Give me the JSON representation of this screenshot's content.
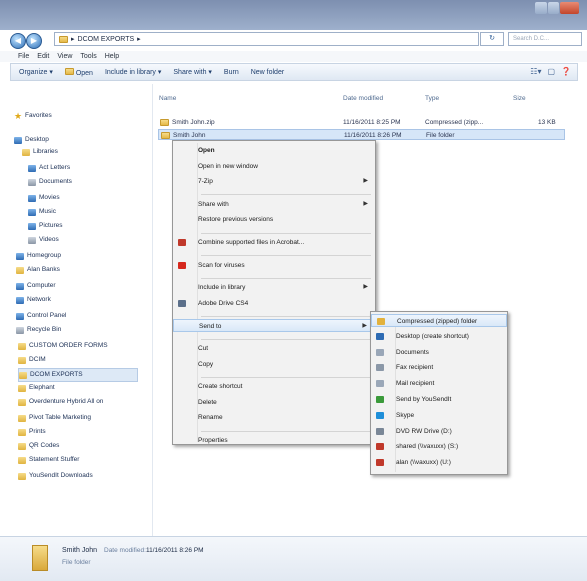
{
  "window": {
    "path": [
      "DCOM EXPORTS"
    ],
    "search_placeholder": "Search D.C...",
    "refresh_label": "↻"
  },
  "menubar": [
    "File",
    "Edit",
    "View",
    "Tools",
    "Help"
  ],
  "toolbar": {
    "organize": "Organize ▾",
    "open": "Open",
    "include": "Include in library ▾",
    "share": "Share with ▾",
    "burn": "Burn",
    "newfolder": "New folder"
  },
  "columns": {
    "name": "Name",
    "date": "Date modified",
    "type": "Type",
    "size": "Size"
  },
  "files": [
    {
      "name": "Smith John.zip",
      "date": "11/16/2011 8:25 PM",
      "type": "Compressed (zipp...",
      "size": "13 KB"
    },
    {
      "name": "Smith John",
      "date": "11/16/2011 8:26 PM",
      "type": "File folder",
      "size": ""
    }
  ],
  "nav": [
    {
      "label": "Favorites",
      "icon": "star"
    },
    {
      "label": "Desktop",
      "icon": "blue"
    },
    {
      "label": "Libraries",
      "icon": "yellow"
    },
    {
      "label": "Act Letters",
      "icon": "blue"
    },
    {
      "label": "Documents",
      "icon": "gray"
    },
    {
      "label": "Movies",
      "icon": "blue"
    },
    {
      "label": "Music",
      "icon": "blue"
    },
    {
      "label": "Pictures",
      "icon": "blue"
    },
    {
      "label": "Videos",
      "icon": "gray"
    },
    {
      "label": "Homegroup",
      "icon": "blue"
    },
    {
      "label": "Alan Banks",
      "icon": "yellow"
    },
    {
      "label": "Computer",
      "icon": "blue"
    },
    {
      "label": "Network",
      "icon": "blue"
    },
    {
      "label": "Control Panel",
      "icon": "blue"
    },
    {
      "label": "Recycle Bin",
      "icon": "gray"
    },
    {
      "label": "CUSTOM ORDER FORMS",
      "icon": "yellow"
    },
    {
      "label": "DCIM",
      "icon": "yellow"
    },
    {
      "label": "DCOM EXPORTS",
      "icon": "yellow"
    },
    {
      "label": "Elephant",
      "icon": "yellow"
    },
    {
      "label": "Overdenture Hybrid All on",
      "icon": "yellow"
    },
    {
      "label": "Pivot Table Marketing",
      "icon": "yellow"
    },
    {
      "label": "Prints",
      "icon": "yellow"
    },
    {
      "label": "QR Codes",
      "icon": "yellow"
    },
    {
      "label": "Statement Stuffer",
      "icon": "yellow"
    },
    {
      "label": "YouSendIt Downloads",
      "icon": "yellow"
    }
  ],
  "context_menu": [
    {
      "label": "Open",
      "bold": true
    },
    {
      "label": "Open in new window"
    },
    {
      "label": "7-Zip",
      "sub": true
    },
    {
      "sep": true
    },
    {
      "label": "Share with",
      "sub": true
    },
    {
      "label": "Restore previous versions"
    },
    {
      "sep": true
    },
    {
      "label": "Combine supported files in Acrobat...",
      "icon": "#c0392b"
    },
    {
      "sep": true
    },
    {
      "label": "Scan for viruses",
      "icon": "#d6281d"
    },
    {
      "sep": true
    },
    {
      "label": "Include in library",
      "sub": true
    },
    {
      "label": "Adobe Drive CS4",
      "icon": "#5b6f8a"
    },
    {
      "sep": true
    },
    {
      "label": "Send to",
      "sub": true,
      "hl": true
    },
    {
      "sep": true
    },
    {
      "label": "Cut"
    },
    {
      "label": "Copy"
    },
    {
      "sep": true
    },
    {
      "label": "Create shortcut"
    },
    {
      "label": "Delete"
    },
    {
      "label": "Rename"
    },
    {
      "sep": true
    },
    {
      "label": "Properties"
    }
  ],
  "sendto_menu": [
    {
      "label": "Compressed (zipped) folder",
      "icon": "#e2b13c",
      "hl": true
    },
    {
      "label": "Desktop (create shortcut)",
      "icon": "#2e6bb3"
    },
    {
      "label": "Documents",
      "icon": "#9aa7b8"
    },
    {
      "label": "Fax recipient",
      "icon": "#8b98a8"
    },
    {
      "label": "Mail recipient",
      "icon": "#9aa7b8"
    },
    {
      "label": "Send by YouSendIt",
      "icon": "#3a9a3a"
    },
    {
      "label": "Skype",
      "icon": "#1f8fd9"
    },
    {
      "label": "DVD RW Drive (D:)",
      "icon": "#7a8797"
    },
    {
      "label": "shared (\\\\vaxuxx) (S:)",
      "icon": "#c0392b"
    },
    {
      "label": "alan (\\\\vaxuxx) (U:)",
      "icon": "#c0392b"
    }
  ],
  "details": {
    "name": "Smith John",
    "date_label": "Date modified:",
    "date": "11/16/2011 8:26 PM",
    "type": "File folder"
  }
}
